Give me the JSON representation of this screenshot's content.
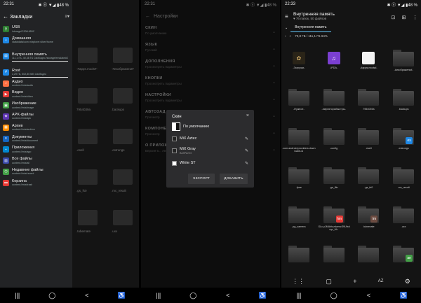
{
  "panel1": {
    "status": {
      "time": "22:31",
      "icons": "✱ ⓝ ▼◢ ▮48 %"
    },
    "drawer_title": "Закладки",
    "items": [
      {
        "name": "USB",
        "sub": "/storage/C308-659C",
        "color": "#2e7d32",
        "icon": "usb-icon",
        "glyph": "⚲"
      },
      {
        "name": "Домашняя",
        "sub": "/data/data/com.mixplorer.silver/home",
        "color": "#1e88e5",
        "icon": "home-icon",
        "glyph": "⌂",
        "tall": true
      },
      {
        "name": "Внутренняя память",
        "sub": "111,1 ГБ, 40,38 ГБ Свободно /storage/emulated/0",
        "color": "#1e88e5",
        "icon": "storage-icon",
        "glyph": "▤",
        "tall": true,
        "bar": true
      },
      {
        "name": "Root",
        "sub": "2,29 ГБ, 502,80 МБ Свободно",
        "color": "#1e88e5",
        "icon": "root-icon",
        "glyph": "#",
        "bar": true
      },
      {
        "name": "Аудио",
        "sub": "content://mix/audio",
        "color": "#ff7043",
        "icon": "audio-icon",
        "glyph": "♪"
      },
      {
        "name": "Видео",
        "sub": "content://mix/video",
        "color": "#e53935",
        "icon": "video-icon",
        "glyph": "▶"
      },
      {
        "name": "Изображение",
        "sub": "content://mix/image",
        "color": "#43a047",
        "icon": "image-icon",
        "glyph": "▣"
      },
      {
        "name": "APK-файлы",
        "sub": "content://mix/apk",
        "color": "#5e35b1",
        "icon": "apk-icon",
        "glyph": "◈"
      },
      {
        "name": "Архив",
        "sub": "content://mix/archive",
        "color": "#fb8c00",
        "icon": "archive-icon",
        "glyph": "▦"
      },
      {
        "name": "Документы",
        "sub": "content://mix/document",
        "color": "#1565c0",
        "icon": "document-icon",
        "glyph": "≡"
      },
      {
        "name": "Приложения",
        "sub": "content://mix/app",
        "color": "#0288d1",
        "icon": "apps-icon",
        "glyph": "▪"
      },
      {
        "name": "Все файлы",
        "sub": "content://mix/all",
        "color": "#3949ab",
        "icon": "all-files-icon",
        "glyph": "▥"
      },
      {
        "name": "Недавние файлы",
        "sub": "content://mix/recent",
        "color": "#43a047",
        "icon": "recent-icon",
        "glyph": "◷"
      },
      {
        "name": "Корзина",
        "sub": "content://mix/trash",
        "color": "#e53935",
        "icon": "trash-icon",
        "glyph": "▬"
      }
    ],
    "bg_labels": [
      "-#apps.mods#-",
      "-#изображени#",
      "7954039a",
      ".backups",
      ".esell",
      ".estrongs",
      ".gs_fs0",
      ".mc_result",
      ".tubemate",
      ".uxx"
    ],
    "bottom_labels": {
      "az": "AZ"
    }
  },
  "panel2": {
    "status": {
      "time": "22:31",
      "icons": "✱ ⓝ ▼◢ ▮48 %"
    },
    "header_title": "Настройки",
    "settings": [
      {
        "title": "СКИН",
        "sub": "По умолчанию"
      },
      {
        "title": "ЯЗЫК",
        "sub": "Русский"
      },
      {
        "title": "ДОПОЛНЕНИЯ",
        "sub": "Просмотреть параметры"
      },
      {
        "title": "КНОПКИ",
        "sub": "Просмотреть параметры"
      },
      {
        "title": "НАСТРОЙКИ",
        "sub": "Просмотреть параметры"
      },
      {
        "title": "АВТОЗАД",
        "sub": "Просмотр"
      },
      {
        "title": "КОМПОНЕН",
        "sub": "Просмотр"
      },
      {
        "title": "О ПРИЛОЖ",
        "sub": "Версия 6... Автор: Hootan... Модифика..."
      }
    ],
    "dialog": {
      "title": "Скин",
      "close": "×",
      "skins": [
        {
          "name": "По умолчанию",
          "sub": "",
          "checked": true,
          "editable": false
        },
        {
          "name": "MiX Aztec",
          "sub": "",
          "checked": false,
          "editable": true
        },
        {
          "name": "MiX Gray",
          "sub": "ВэбРАНО",
          "checked": false,
          "editable": true
        },
        {
          "name": "White ST",
          "sub": "",
          "checked": false,
          "editable": true
        }
      ],
      "export_label": "ЭКСПОРТ",
      "add_label": "ДОБАВИТЬ"
    },
    "bottom_labels": {
      "az": "AZ"
    }
  },
  "panel3": {
    "status": {
      "time": "22:33",
      "icons": "✱ ⓝ ▼◢ ▮48 %"
    },
    "title": "Внутренняя память",
    "subtitle": "♥ 76 папок, 50 файлов",
    "tab_label": "Внутренняя память",
    "path_info": "70,8 ГБ / 111,1 ГБ   64%",
    "cells": [
      {
        "label": "-Загрузки-",
        "kind": "thumb",
        "thumb_color": "#2a2418",
        "glyph": "✿",
        "glyph_color": "#d9b36a"
      },
      {
        "label": "-IPDA-",
        "kind": "thumb",
        "thumb_color": "#7b3fd1",
        "glyph": "♫",
        "glyph_color": "#fff"
      },
      {
        "label": "-#apps.mods#-",
        "kind": "thumb",
        "thumb_color": "#f2f2f2",
        "glyph": "",
        "glyph_color": "#000"
      },
      {
        "label": "-#изображени#-",
        "kind": "folder",
        "badge": ""
      },
      {
        "label": "-Нужное-",
        "kind": "folder",
        "badge": ""
      },
      {
        "label": "-эмуляторыбыстры-",
        "kind": "folder",
        "badge": ""
      },
      {
        "label": "7954039a",
        "kind": "folder",
        "badge": ""
      },
      {
        "label": ".backups",
        "kind": "folder",
        "badge": ""
      },
      {
        "label": ".com.android.providers.downloads.ui",
        "kind": "folder",
        "badge": ""
      },
      {
        "label": ".config",
        "kind": "folder",
        "badge": ""
      },
      {
        "label": ".esell",
        "kind": "folder",
        "badge": ""
      },
      {
        "label": ".estrongs",
        "kind": "folder",
        "badge": "es"
      },
      {
        "label": ".fpse",
        "kind": "folder",
        "badge": ""
      },
      {
        "label": ".gs_file",
        "kind": "folder",
        "badge": ""
      },
      {
        "label": ".gs_fs0",
        "kind": "folder",
        "badge": ""
      },
      {
        "label": ".mc_result",
        "kind": "folder",
        "badge": ""
      },
      {
        "label": ".pg_camera",
        "kind": "folder",
        "badge": ""
      },
      {
        "label": ".SLc yJMAhtczdwmcS9Ufxdeyr_M=",
        "kind": "folder",
        "badge": "hm"
      },
      {
        "label": ".tubemate",
        "kind": "folder",
        "badge": "tm"
      },
      {
        "label": ".uxx",
        "kind": "folder",
        "badge": ""
      },
      {
        "label": "",
        "kind": "folder",
        "badge": ""
      },
      {
        "label": "",
        "kind": "folder",
        "badge": ""
      },
      {
        "label": "",
        "kind": "folder",
        "badge": ""
      },
      {
        "label": "",
        "kind": "folder",
        "badge": "an"
      }
    ],
    "bottom_az": "AZ"
  }
}
